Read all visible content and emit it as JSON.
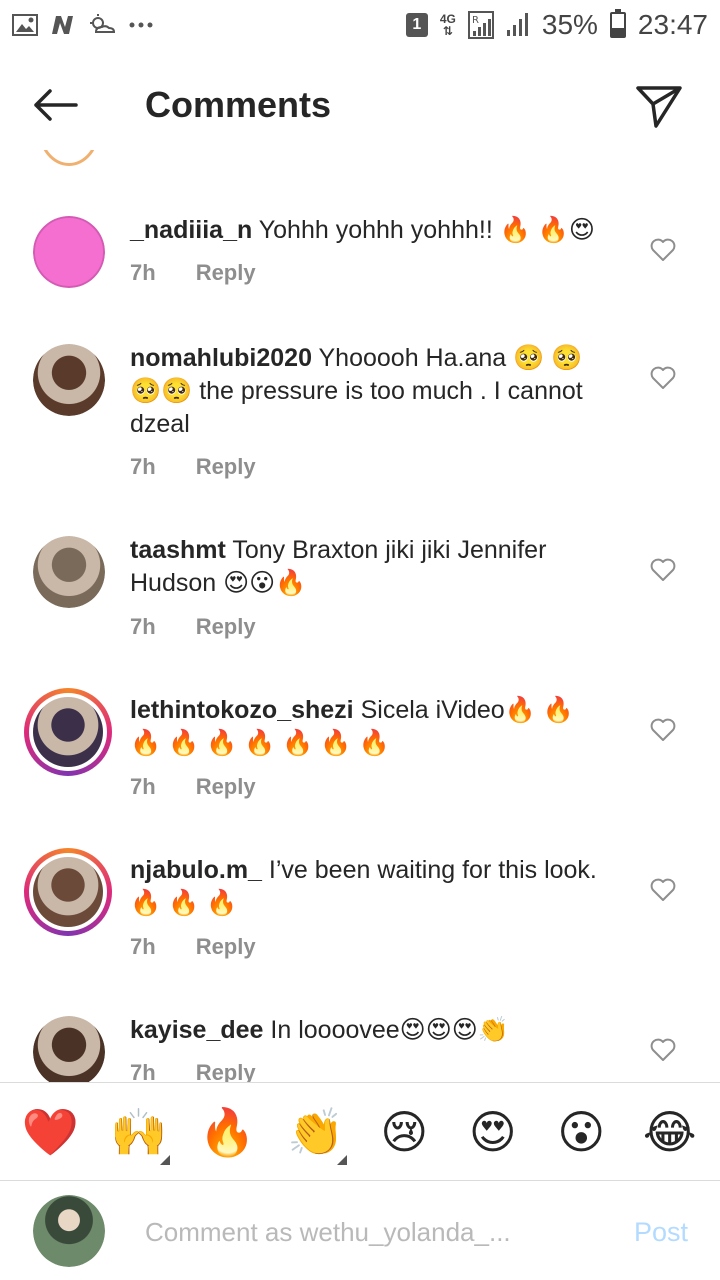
{
  "status_bar": {
    "sim_slot": "1",
    "network": "4G",
    "battery": "35%",
    "battery_level": 0.35,
    "time": "23:47",
    "left_icons": [
      "gallery-icon",
      "n-app-icon",
      "weather-icon",
      "more-dots-icon"
    ]
  },
  "header": {
    "title": "Comments",
    "back_icon": "arrow-left-icon",
    "share_icon": "paper-plane-icon"
  },
  "comments": [
    {
      "username": "_nadiiia_n",
      "text": "Yohhh yohhh yohhh!! 🔥 🔥😍",
      "time": "7h",
      "reply": "Reply",
      "avatar_color": "#f46fd0",
      "ring": false
    },
    {
      "username": "nomahlubi2020",
      "text": "Yhooooh Ha.ana 🥺 🥺🥺🥺 the pressure is too much . I cannot dzeal",
      "time": "7h",
      "reply": "Reply",
      "avatar_color": "#5a3b2b",
      "ring": false
    },
    {
      "username": "taashmt",
      "text": "Tony Braxton jiki jiki Jennifer Hudson 😍😮🔥",
      "time": "7h",
      "reply": "Reply",
      "avatar_color": "#7a6a5a",
      "ring": false
    },
    {
      "username": "lethintokozo_shezi",
      "text": "Sicela iVideo🔥 🔥 🔥 🔥 🔥 🔥 🔥 🔥 🔥",
      "time": "7h",
      "reply": "Reply",
      "avatar_color": "#3b2f4a",
      "ring": true
    },
    {
      "username": "njabulo.m_",
      "text": "I’ve been waiting for this look. 🔥 🔥 🔥",
      "time": "7h",
      "reply": "Reply",
      "avatar_color": "#6b4a3a",
      "ring": true
    },
    {
      "username": "kayise_dee",
      "text": "In loooovee😍😍😍👏",
      "time": "7h",
      "reply": "Reply",
      "avatar_color": "#4a3226",
      "ring": false
    }
  ],
  "emoji_bar": [
    "❤️",
    "🙌",
    "🔥",
    "👏",
    "😢",
    "😍",
    "😮",
    "😂"
  ],
  "composer": {
    "placeholder": "Comment as wethu_yolanda_...",
    "post_label": "Post"
  }
}
